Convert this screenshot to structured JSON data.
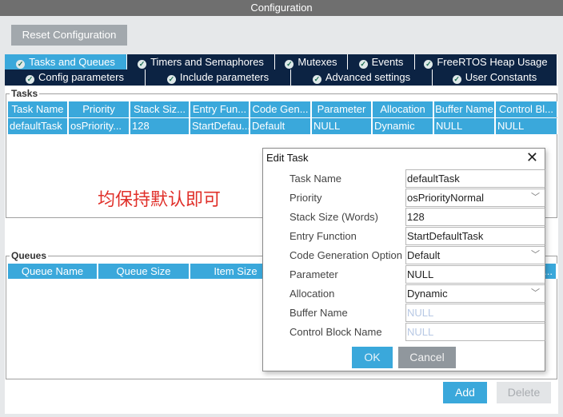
{
  "window": {
    "title": "Configuration"
  },
  "toolbar": {
    "reset_label": "Reset Configuration"
  },
  "tabs_row1": [
    {
      "label": "Tasks and Queues",
      "active": true
    },
    {
      "label": "Timers and Semaphores"
    },
    {
      "label": "Mutexes"
    },
    {
      "label": "Events"
    },
    {
      "label": "FreeRTOS Heap Usage"
    }
  ],
  "tabs_row2": [
    {
      "label": "Config parameters"
    },
    {
      "label": "Include parameters"
    },
    {
      "label": "Advanced settings"
    },
    {
      "label": "User Constants"
    }
  ],
  "tasks": {
    "label": "Tasks",
    "columns": [
      "Task Name",
      "Priority",
      "Stack Siz...",
      "Entry Fun...",
      "Code Gen...",
      "Parameter",
      "Allocation",
      "Buffer Name",
      "Control Bl..."
    ],
    "rows": [
      [
        "defaultTask",
        "osPriority...",
        "128",
        "StartDefau...",
        "Default",
        "NULL",
        "Dynamic",
        "NULL",
        "NULL"
      ]
    ]
  },
  "annotation": "均保持默认即可",
  "queues": {
    "label": "Queues",
    "columns": [
      "Queue Name",
      "Queue Size",
      "Item Size",
      "",
      "",
      "..."
    ]
  },
  "actions": {
    "add": "Add",
    "delete": "Delete"
  },
  "dialog": {
    "title": "Edit Task",
    "ok": "OK",
    "cancel": "Cancel",
    "fields": [
      {
        "label": "Task Name",
        "value": "defaultTask",
        "type": "text"
      },
      {
        "label": "Priority",
        "value": "osPriorityNormal",
        "type": "select"
      },
      {
        "label": "Stack Size (Words)",
        "value": "128",
        "type": "text"
      },
      {
        "label": "Entry Function",
        "value": "StartDefaultTask",
        "type": "text"
      },
      {
        "label": "Code Generation Option",
        "value": "Default",
        "type": "select"
      },
      {
        "label": "Parameter",
        "value": "NULL",
        "type": "text"
      },
      {
        "label": "Allocation",
        "value": "Dynamic",
        "type": "select"
      },
      {
        "label": "Buffer Name",
        "value": "NULL",
        "type": "text",
        "disabled": true
      },
      {
        "label": "Control Block Name",
        "value": "NULL",
        "type": "text",
        "disabled": true
      }
    ]
  },
  "colors": {
    "accent": "#3aa8db",
    "tab_dark": "#0c2343",
    "annotation": "#e0302a"
  }
}
